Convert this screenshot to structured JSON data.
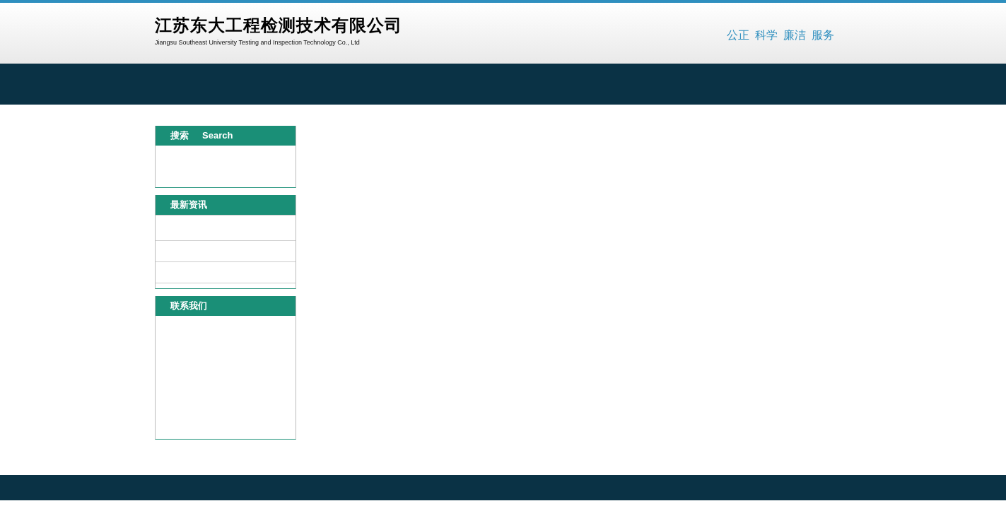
{
  "header": {
    "company_name": "江苏东大工程检测技术有限公司",
    "company_name_en": "Jiangsu Southeast University Testing and Inspection Technology Co., Ltd",
    "slogan": [
      "公正",
      "科学",
      "廉洁",
      "服务"
    ]
  },
  "sidebar": {
    "panels": [
      {
        "kind": "search",
        "title": "搜索",
        "subtitle": "Search"
      },
      {
        "kind": "list",
        "title": "最新资讯"
      },
      {
        "kind": "contact",
        "title": "联系我们"
      }
    ]
  }
}
